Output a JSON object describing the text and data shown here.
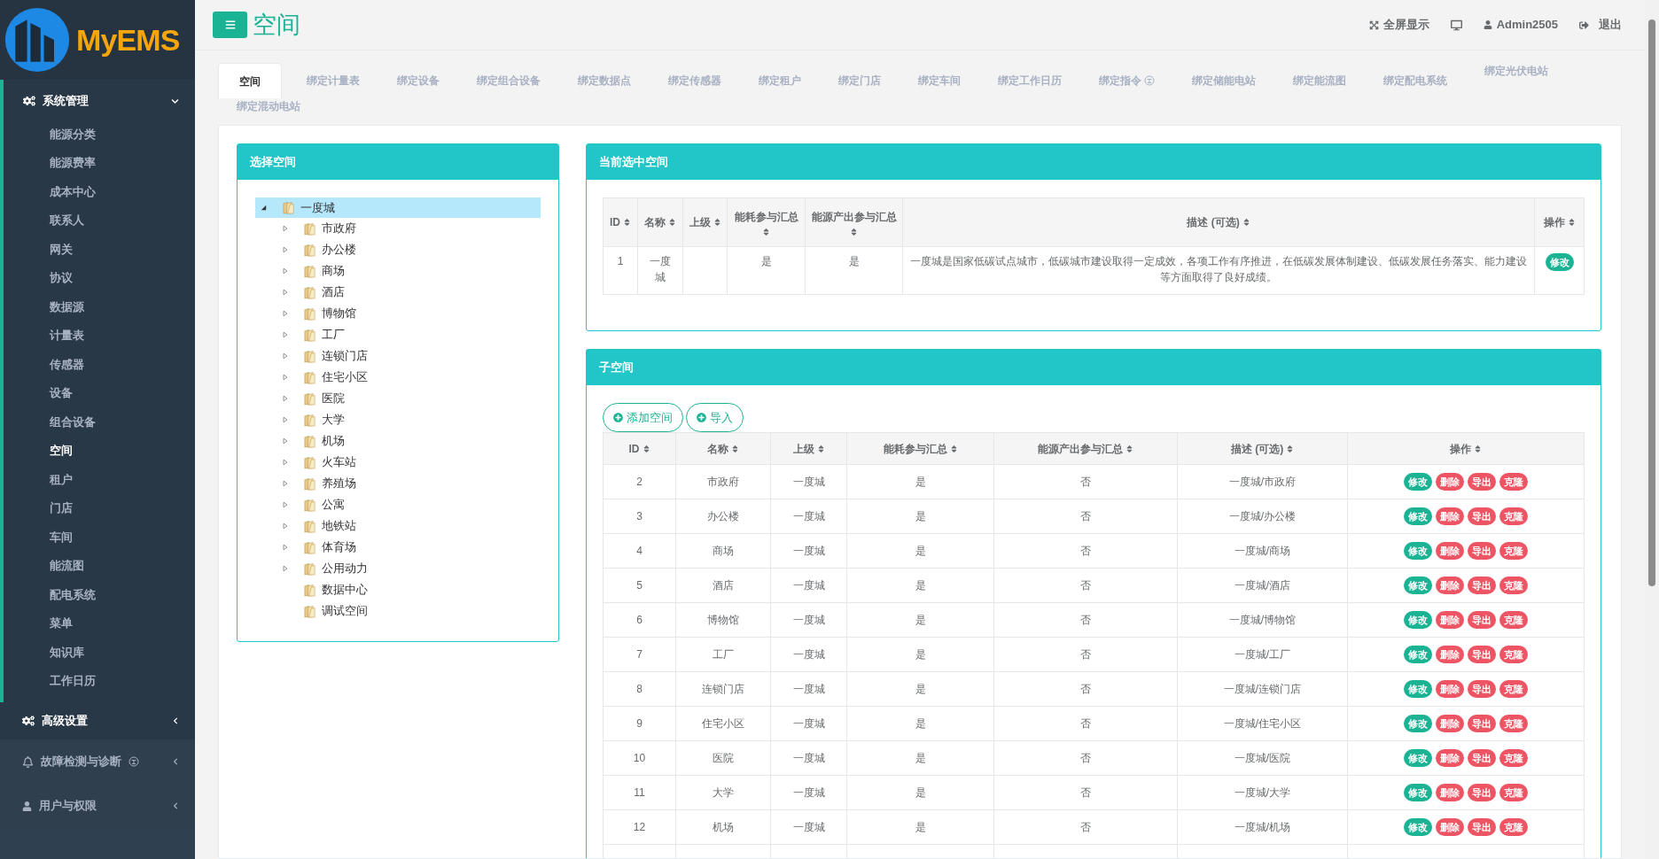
{
  "brand": {
    "name": "MyEMS"
  },
  "sidebar": {
    "sections": [
      {
        "label": "系统管理",
        "kind": "main",
        "expanded": true,
        "items": [
          {
            "label": "能源分类",
            "selected": false
          },
          {
            "label": "能源费率",
            "selected": false
          },
          {
            "label": "成本中心",
            "selected": false
          },
          {
            "label": "联系人",
            "selected": false
          },
          {
            "label": "网关",
            "selected": false
          },
          {
            "label": "协议",
            "selected": false
          },
          {
            "label": "数据源",
            "selected": false
          },
          {
            "label": "计量表",
            "selected": false
          },
          {
            "label": "传感器",
            "selected": false
          },
          {
            "label": "设备",
            "selected": false
          },
          {
            "label": "组合设备",
            "selected": false
          },
          {
            "label": "空间",
            "selected": true
          },
          {
            "label": "租户",
            "selected": false
          },
          {
            "label": "门店",
            "selected": false
          },
          {
            "label": "车间",
            "selected": false
          },
          {
            "label": "能流图",
            "selected": false
          },
          {
            "label": "配电系统",
            "selected": false
          },
          {
            "label": "菜单",
            "selected": false
          },
          {
            "label": "知识库",
            "selected": false
          },
          {
            "label": "工作日历",
            "selected": false
          }
        ]
      },
      {
        "label": "高级设置",
        "kind": "main",
        "expanded": false
      },
      {
        "label": "故障检测与诊断",
        "kind": "muted",
        "badge": true,
        "expanded": false
      },
      {
        "label": "用户与权限",
        "kind": "muted",
        "expanded": false
      }
    ]
  },
  "header": {
    "title": "空间",
    "actions": [
      {
        "kind": "fullscreen",
        "label": "全屏显示"
      },
      {
        "kind": "monitor"
      },
      {
        "kind": "user",
        "label": "Admin2505"
      },
      {
        "kind": "logout",
        "label": "退出"
      }
    ]
  },
  "tabs": [
    {
      "label": "空间",
      "selected": true
    },
    {
      "label": "绑定计量表",
      "selected": false
    },
    {
      "label": "绑定设备",
      "selected": false
    },
    {
      "label": "绑定组合设备",
      "selected": false
    },
    {
      "label": "绑定数据点",
      "selected": false
    },
    {
      "label": "绑定传感器",
      "selected": false
    },
    {
      "label": "绑定租户",
      "selected": false
    },
    {
      "label": "绑定门店",
      "selected": false
    },
    {
      "label": "绑定车间",
      "selected": false
    },
    {
      "label": "绑定工作日历",
      "selected": false
    },
    {
      "label": "绑定指令",
      "selected": false,
      "badge": true
    },
    {
      "label": "绑定储能电站",
      "selected": false
    },
    {
      "label": "绑定能流图",
      "selected": false
    },
    {
      "label": "绑定配电系统",
      "selected": false
    },
    {
      "label": "绑定光伏电站",
      "selected": false
    },
    {
      "label": "绑定混动电站",
      "selected": false
    }
  ],
  "tree": {
    "title": "选择空间",
    "root": {
      "label": "一度城",
      "expanded": true,
      "selected": true,
      "children": [
        {
          "label": "市政府",
          "has_children": true
        },
        {
          "label": "办公楼",
          "has_children": true
        },
        {
          "label": "商场",
          "has_children": true
        },
        {
          "label": "酒店",
          "has_children": true
        },
        {
          "label": "博物馆",
          "has_children": true
        },
        {
          "label": "工厂",
          "has_children": true
        },
        {
          "label": "连锁门店",
          "has_children": true
        },
        {
          "label": "住宅小区",
          "has_children": true
        },
        {
          "label": "医院",
          "has_children": true
        },
        {
          "label": "大学",
          "has_children": true
        },
        {
          "label": "机场",
          "has_children": true
        },
        {
          "label": "火车站",
          "has_children": true
        },
        {
          "label": "养殖场",
          "has_children": true
        },
        {
          "label": "公寓",
          "has_children": true
        },
        {
          "label": "地铁站",
          "has_children": true
        },
        {
          "label": "体育场",
          "has_children": true
        },
        {
          "label": "公用动力",
          "has_children": true
        },
        {
          "label": "数据中心",
          "has_children": false
        },
        {
          "label": "调试空间",
          "has_children": false
        }
      ]
    }
  },
  "current": {
    "title": "当前选中空间",
    "columns": [
      "ID",
      "名称",
      "上级",
      "能耗参与汇总",
      "能源产出参与汇总",
      "描述 (可选)",
      "操作"
    ],
    "row": {
      "cells": [
        "1",
        "一度城",
        "",
        "是",
        "是",
        "一度城是国家低碳试点城市，低碳城市建设取得一定成效，各项工作有序推进，在低碳发展体制建设、低碳发展任务落实、能力建设等方面取得了良好成绩。"
      ],
      "actions": [
        {
          "label": "修改",
          "kind": "edit"
        }
      ]
    }
  },
  "children": {
    "title": "子空间",
    "buttons": [
      "添加空间",
      "导入"
    ],
    "columns": [
      "ID",
      "名称",
      "上级",
      "能耗参与汇总",
      "能源产出参与汇总",
      "描述 (可选)",
      "操作"
    ],
    "rows": [
      {
        "cells": [
          "2",
          "市政府",
          "一度城",
          "是",
          "否",
          "一度城/市政府"
        ],
        "actions": [
          {
            "label": "修改",
            "kind": "edit"
          },
          {
            "label": "删除",
            "kind": "danger"
          },
          {
            "label": "导出",
            "kind": "danger"
          },
          {
            "label": "克隆",
            "kind": "danger"
          }
        ]
      },
      {
        "cells": [
          "3",
          "办公楼",
          "一度城",
          "是",
          "否",
          "一度城/办公楼"
        ],
        "actions": [
          {
            "label": "修改",
            "kind": "edit"
          },
          {
            "label": "删除",
            "kind": "danger"
          },
          {
            "label": "导出",
            "kind": "danger"
          },
          {
            "label": "克隆",
            "kind": "danger"
          }
        ]
      },
      {
        "cells": [
          "4",
          "商场",
          "一度城",
          "是",
          "否",
          "一度城/商场"
        ],
        "actions": [
          {
            "label": "修改",
            "kind": "edit"
          },
          {
            "label": "删除",
            "kind": "danger"
          },
          {
            "label": "导出",
            "kind": "danger"
          },
          {
            "label": "克隆",
            "kind": "danger"
          }
        ]
      },
      {
        "cells": [
          "5",
          "酒店",
          "一度城",
          "是",
          "否",
          "一度城/酒店"
        ],
        "actions": [
          {
            "label": "修改",
            "kind": "edit"
          },
          {
            "label": "删除",
            "kind": "danger"
          },
          {
            "label": "导出",
            "kind": "danger"
          },
          {
            "label": "克隆",
            "kind": "danger"
          }
        ]
      },
      {
        "cells": [
          "6",
          "博物馆",
          "一度城",
          "是",
          "否",
          "一度城/博物馆"
        ],
        "actions": [
          {
            "label": "修改",
            "kind": "edit"
          },
          {
            "label": "删除",
            "kind": "danger"
          },
          {
            "label": "导出",
            "kind": "danger"
          },
          {
            "label": "克隆",
            "kind": "danger"
          }
        ]
      },
      {
        "cells": [
          "7",
          "工厂",
          "一度城",
          "是",
          "否",
          "一度城/工厂"
        ],
        "actions": [
          {
            "label": "修改",
            "kind": "edit"
          },
          {
            "label": "删除",
            "kind": "danger"
          },
          {
            "label": "导出",
            "kind": "danger"
          },
          {
            "label": "克隆",
            "kind": "danger"
          }
        ]
      },
      {
        "cells": [
          "8",
          "连锁门店",
          "一度城",
          "是",
          "否",
          "一度城/连锁门店"
        ],
        "actions": [
          {
            "label": "修改",
            "kind": "edit"
          },
          {
            "label": "删除",
            "kind": "danger"
          },
          {
            "label": "导出",
            "kind": "danger"
          },
          {
            "label": "克隆",
            "kind": "danger"
          }
        ]
      },
      {
        "cells": [
          "9",
          "住宅小区",
          "一度城",
          "是",
          "否",
          "一度城/住宅小区"
        ],
        "actions": [
          {
            "label": "修改",
            "kind": "edit"
          },
          {
            "label": "删除",
            "kind": "danger"
          },
          {
            "label": "导出",
            "kind": "danger"
          },
          {
            "label": "克隆",
            "kind": "danger"
          }
        ]
      },
      {
        "cells": [
          "10",
          "医院",
          "一度城",
          "是",
          "否",
          "一度城/医院"
        ],
        "actions": [
          {
            "label": "修改",
            "kind": "edit"
          },
          {
            "label": "删除",
            "kind": "danger"
          },
          {
            "label": "导出",
            "kind": "danger"
          },
          {
            "label": "克隆",
            "kind": "danger"
          }
        ]
      },
      {
        "cells": [
          "11",
          "大学",
          "一度城",
          "是",
          "否",
          "一度城/大学"
        ],
        "actions": [
          {
            "label": "修改",
            "kind": "edit"
          },
          {
            "label": "删除",
            "kind": "danger"
          },
          {
            "label": "导出",
            "kind": "danger"
          },
          {
            "label": "克隆",
            "kind": "danger"
          }
        ]
      },
      {
        "cells": [
          "12",
          "机场",
          "一度城",
          "是",
          "否",
          "一度城/机场"
        ],
        "actions": [
          {
            "label": "修改",
            "kind": "edit"
          },
          {
            "label": "删除",
            "kind": "danger"
          },
          {
            "label": "导出",
            "kind": "danger"
          },
          {
            "label": "克隆",
            "kind": "danger"
          }
        ]
      }
    ]
  }
}
